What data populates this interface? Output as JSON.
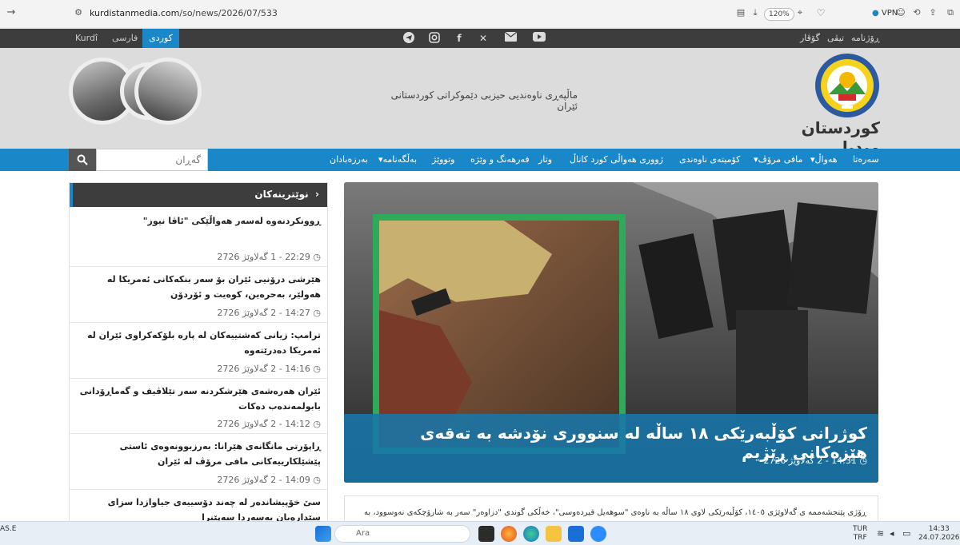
{
  "browser": {
    "url_domain": "kurdistanmedia.com",
    "url_path": "/so/news/2026/07/533",
    "zoom": "120%",
    "vpn_label": "VPN"
  },
  "topbar": {
    "languages": [
      {
        "label": "Kurdî",
        "active": false
      },
      {
        "label": "فارسی",
        "active": false
      },
      {
        "label": "کوردی",
        "active": true
      }
    ],
    "links": [
      "ڕۆژنامە",
      "تیڤی",
      "گۆڤار"
    ],
    "social_icons": [
      "telegram-icon",
      "instagram-icon",
      "facebook-icon",
      "x-icon",
      "mail-icon",
      "youtube-icon"
    ]
  },
  "header": {
    "site_name": "کوردستان میدیا",
    "tagline": "ماڵپەڕی ناوەندیی حیزبی دێموکراتی کوردستانی ئێران"
  },
  "nav": {
    "items": [
      "سەرەتا",
      "هەواڵ▾",
      "مافی مرۆڤ▾",
      "کۆمیتەی ناوەندی",
      "ژووری هەواڵی کورد کاناڵ",
      "وتار",
      "فەرهەنگ و وێژە",
      "وتووێژ",
      "بەڵگەنامە▾",
      "بەرزەبادان"
    ],
    "search_placeholder": "گەڕان"
  },
  "latest": {
    "heading": "نوێترینەکان",
    "items": [
      {
        "title": "ڕوونکردنەوە لەسەر هەواڵێکی \"ئاڤا نیوز\"",
        "meta": "22:29 - 1 گەلاوێژ 2726"
      },
      {
        "title": "هێرشی درۆنیی ئێران بۆ سەر بنکەکانی ئەمریکا لە هەولێر، بەحرەین، کوەیت و ئۆردۆن",
        "meta": "14:27 - 2 گەلاوێژ 2726"
      },
      {
        "title": "ترامپ: زیانی کەشتییەکان لە پارە بلۆکەکراوی ئێران لە ئەمریکا دەدرێتەوە",
        "meta": "14:16 - 2 گەلاوێژ 2726"
      },
      {
        "title": "ئێران هەرەشەی هێرشکردنە سەر تێلاڤیف و گەماڕۆدانی بابولمەندەب دەکات",
        "meta": "14:12 - 2 گەلاوێژ 2726"
      },
      {
        "title": "ڕاپۆرتی مانگانەی هێرانا: بەرزبوونەوەی ئاستی پێشێلکارییەکانی مافی مرۆڤ لە ئێران",
        "meta": "14:09 - 2 گەلاوێژ 2726"
      },
      {
        "title": "سێ خۆپیشاندەر لە چەند دۆسییەی جیاوازدا سزای سێدارەیان بەسەردا سەپێنرا",
        "meta": ""
      }
    ]
  },
  "feature": {
    "title": "کوژرانی کۆڵبەرێکی ١٨ ساڵە لە سنووری نۆدشە بە تەقەی هێزەکانی ڕێژیم",
    "meta": "14:31 - 2 گەلاوێژ 2726"
  },
  "article": {
    "lead": "ڕۆژی پێنجشەممە ی گەلاوێژی ١٤٠٥، کۆڵبەرێکی لاوی ١٨ ساڵە بە ناوەی \"سوهەیل فیردەوسی\"، خەڵکی گوندی \"دزاوەر\" سەر بە شارۆچکەی نەوسوود، بە"
  },
  "taskbar": {
    "search_label": "Ara",
    "weather_label": "AS.E",
    "lang_top": "TUR",
    "lang_bottom": "TRF",
    "time": "14:33",
    "date": "24.07.2026"
  }
}
